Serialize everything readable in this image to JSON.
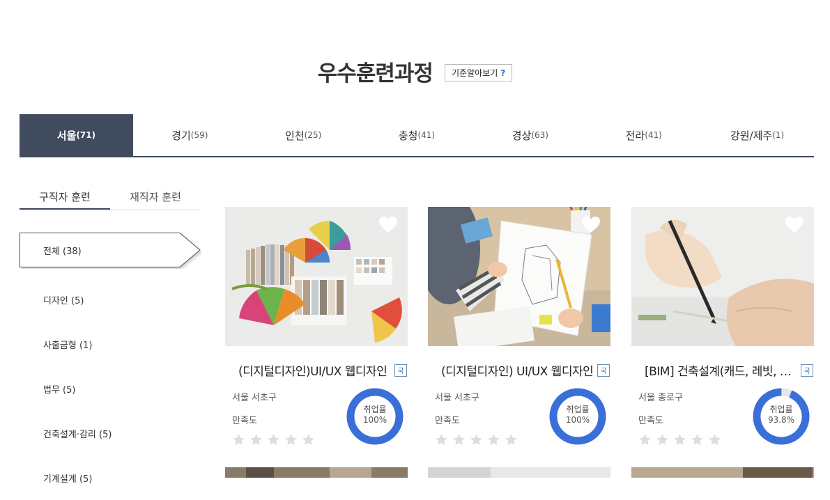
{
  "header": {
    "title": "우수훈련과정",
    "criteria_label": "기준알아보기",
    "criteria_q": "?"
  },
  "regions": [
    {
      "name": "서울",
      "count": "(71)",
      "active": true
    },
    {
      "name": "경기",
      "count": "(59)"
    },
    {
      "name": "인천",
      "count": "(25)"
    },
    {
      "name": "충청",
      "count": "(41)"
    },
    {
      "name": "경상",
      "count": "(63)"
    },
    {
      "name": "전라",
      "count": "(41)"
    },
    {
      "name": "강원/제주",
      "count": "(1)"
    }
  ],
  "sub_tabs": [
    "구직자 훈련",
    "재직자 훈련"
  ],
  "categories": [
    "전체 (38)",
    "디자인 (5)",
    "사출금형 (1)",
    "법무 (5)",
    "건축설계·감리 (5)",
    "기계설계 (5)"
  ],
  "cards": [
    {
      "title": "(디지털디자인)UI/UX 웹디자인",
      "badge": "국",
      "location": "서울 서초구",
      "satisfaction_label": "만족도",
      "rating": 0,
      "rate_label": "취업률",
      "rate": "100%",
      "rate_value": 1.0
    },
    {
      "title": "(디지털디자인) UI/UX 웹디자인",
      "badge": "국",
      "location": "서울 서초구",
      "satisfaction_label": "만족도",
      "rating": 0,
      "rate_label": "취업률",
      "rate": "100%",
      "rate_value": 1.0
    },
    {
      "title": "[BIM] 건축설계(캐드, 레빗, 스케치업)",
      "badge": "국",
      "location": "서울 종로구",
      "satisfaction_label": "만족도",
      "rating": 0,
      "rate_label": "취업률",
      "rate": "93.8%",
      "rate_value": 0.938
    }
  ],
  "colors": {
    "accent": "#404b5e",
    "gauge": "#3b6fd8",
    "gauge_track": "#e6e6e6",
    "star_empty": "#dddddd"
  }
}
